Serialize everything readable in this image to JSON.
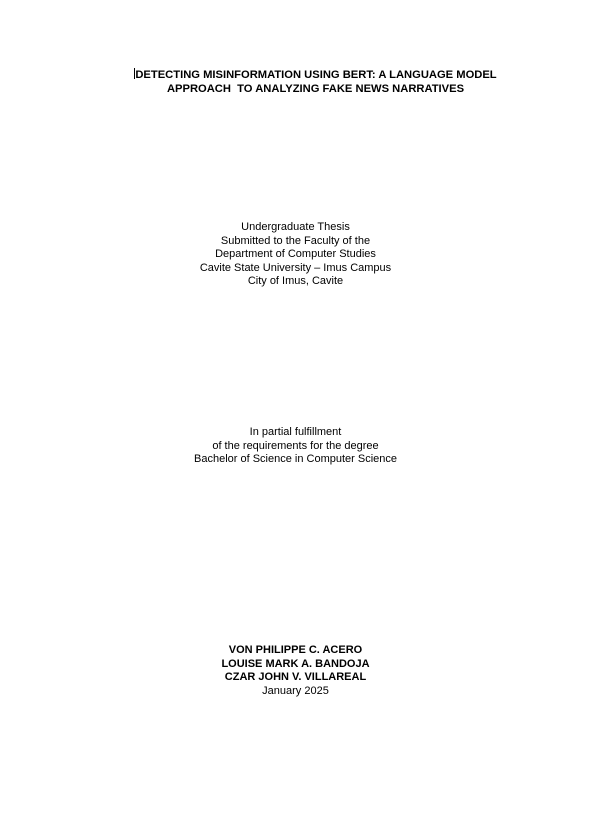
{
  "title": {
    "line1": "DETECTING MISINFORMATION USING BERT: A LANGUAGE MODEL",
    "line2": "APPROACH  TO ANALYZING FAKE NEWS NARRATIVES"
  },
  "submission": {
    "line1": "Undergraduate Thesis",
    "line2": "Submitted to the Faculty of the",
    "line3": "Department of Computer Studies",
    "line4": "Cavite State University – Imus Campus",
    "line5": "City of Imus, Cavite"
  },
  "fulfillment": {
    "line1": "In partial fulfillment",
    "line2": "of the requirements for the degree",
    "line3": "Bachelor of Science in Computer Science"
  },
  "authors": [
    "VON PHILIPPE C. ACERO",
    "LOUISE MARK A. BANDOJA",
    "CZAR JOHN V. VILLAREAL"
  ],
  "date": "January 2025"
}
